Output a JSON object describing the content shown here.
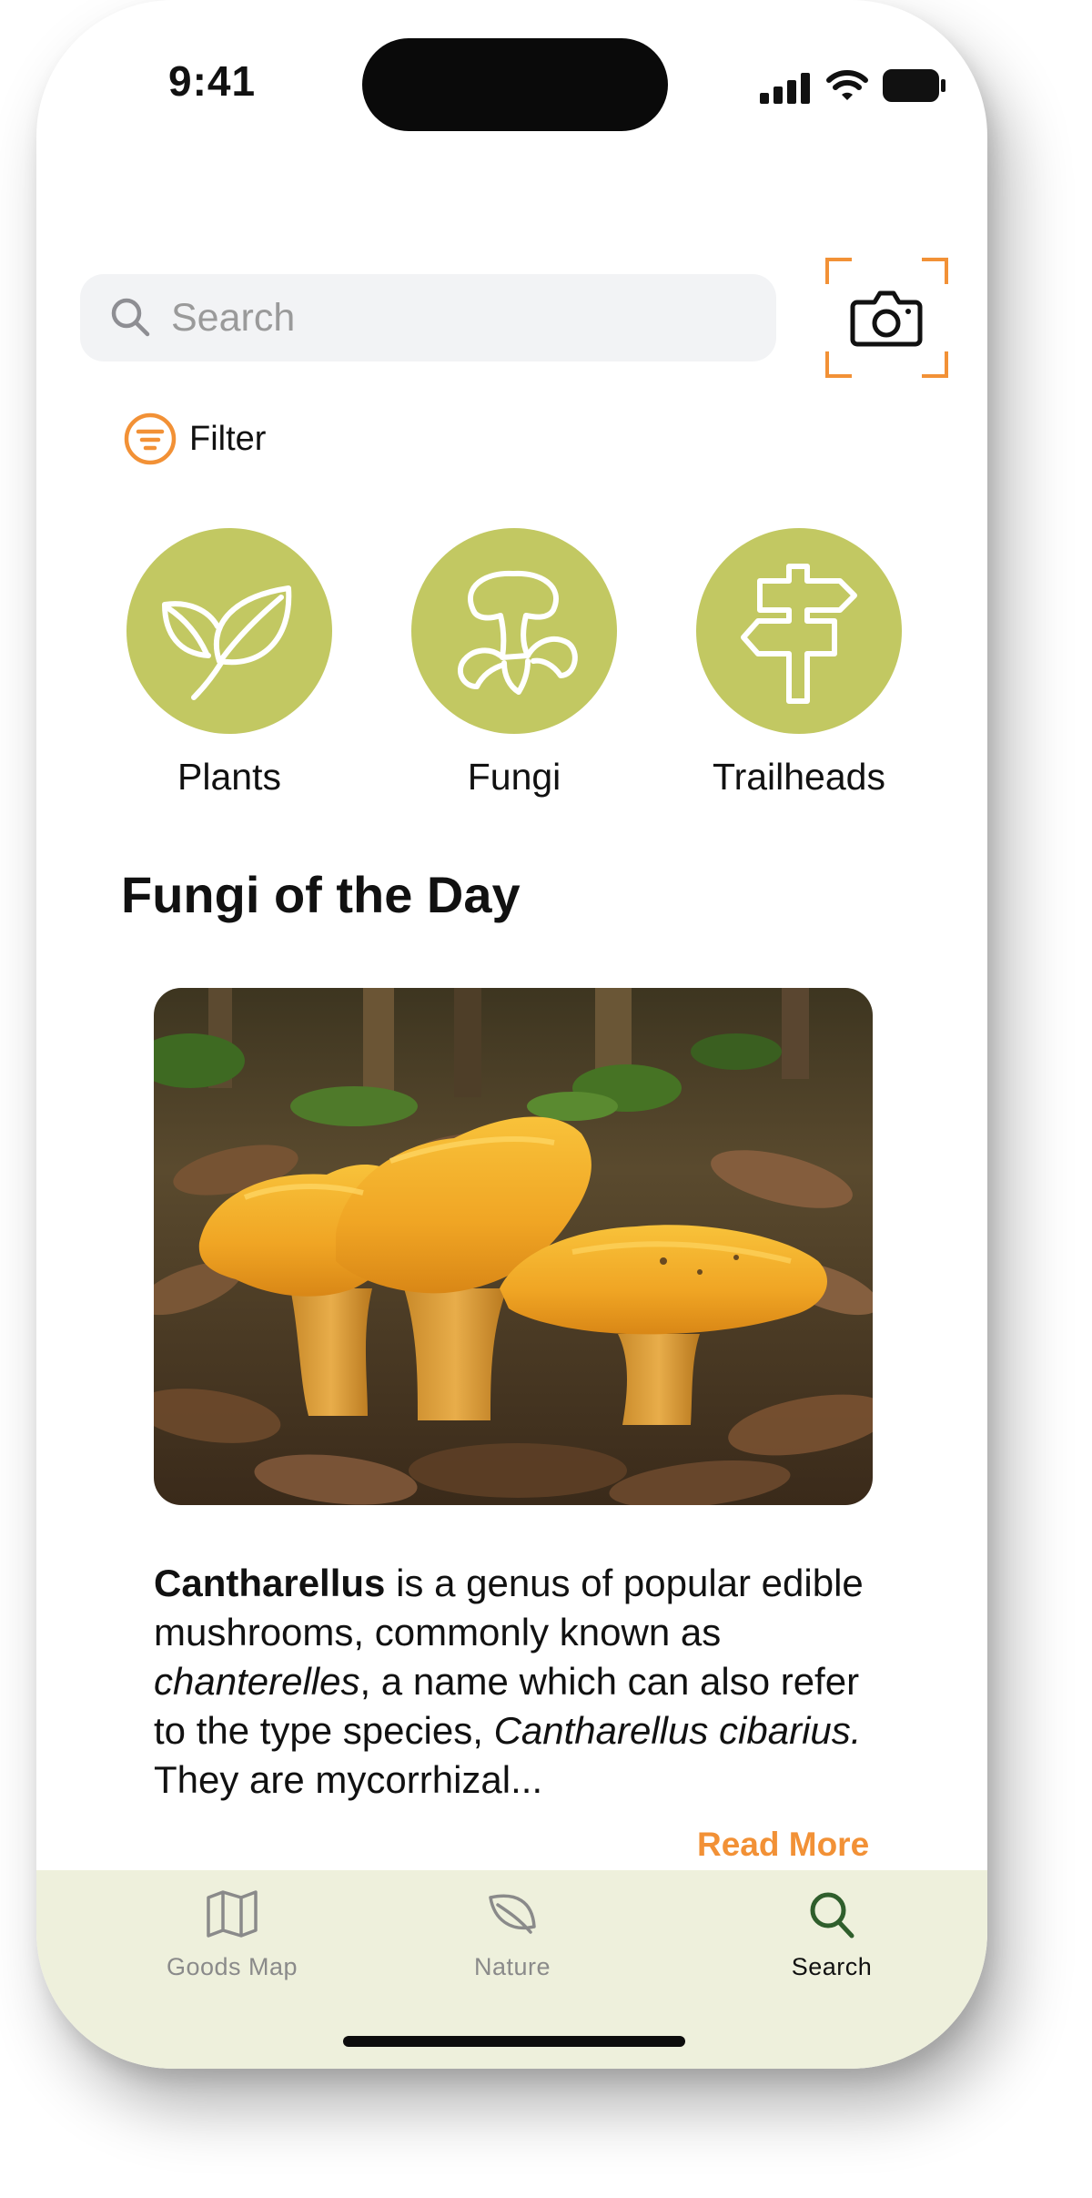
{
  "status_bar": {
    "time": "9:41"
  },
  "search": {
    "placeholder": "Search"
  },
  "filter": {
    "label": "Filter"
  },
  "categories": [
    {
      "label": "Plants",
      "icon": "leaf-icon"
    },
    {
      "label": "Fungi",
      "icon": "mushroom-icon"
    },
    {
      "label": "Trailheads",
      "icon": "signpost-icon"
    }
  ],
  "featured": {
    "heading": "Fungi of the Day",
    "image": "chanterelle-mushrooms-photo",
    "desc_part1": "Cantharellus",
    "desc_part2": " is a genus of popular edible mushrooms, commonly known as ",
    "desc_part3": "chanterelles",
    "desc_part4": ", a name which can also refer to the type species, ",
    "desc_part5": "Cantharellus cibarius.",
    "desc_part6": " They are mycorrhizal...",
    "read_more": "Read More"
  },
  "tab_bar": {
    "tabs": [
      {
        "label": "Goods Map",
        "icon": "map-icon",
        "active": false
      },
      {
        "label": "Nature",
        "icon": "leaf-outline-icon",
        "active": false
      },
      {
        "label": "Search",
        "icon": "search-icon",
        "active": true
      }
    ]
  },
  "colors": {
    "accent_orange": "#f29136",
    "category_green": "#c2c862",
    "tabbar_bg": "#eef0dc",
    "active_tab_icon": "#2f5e2c"
  }
}
